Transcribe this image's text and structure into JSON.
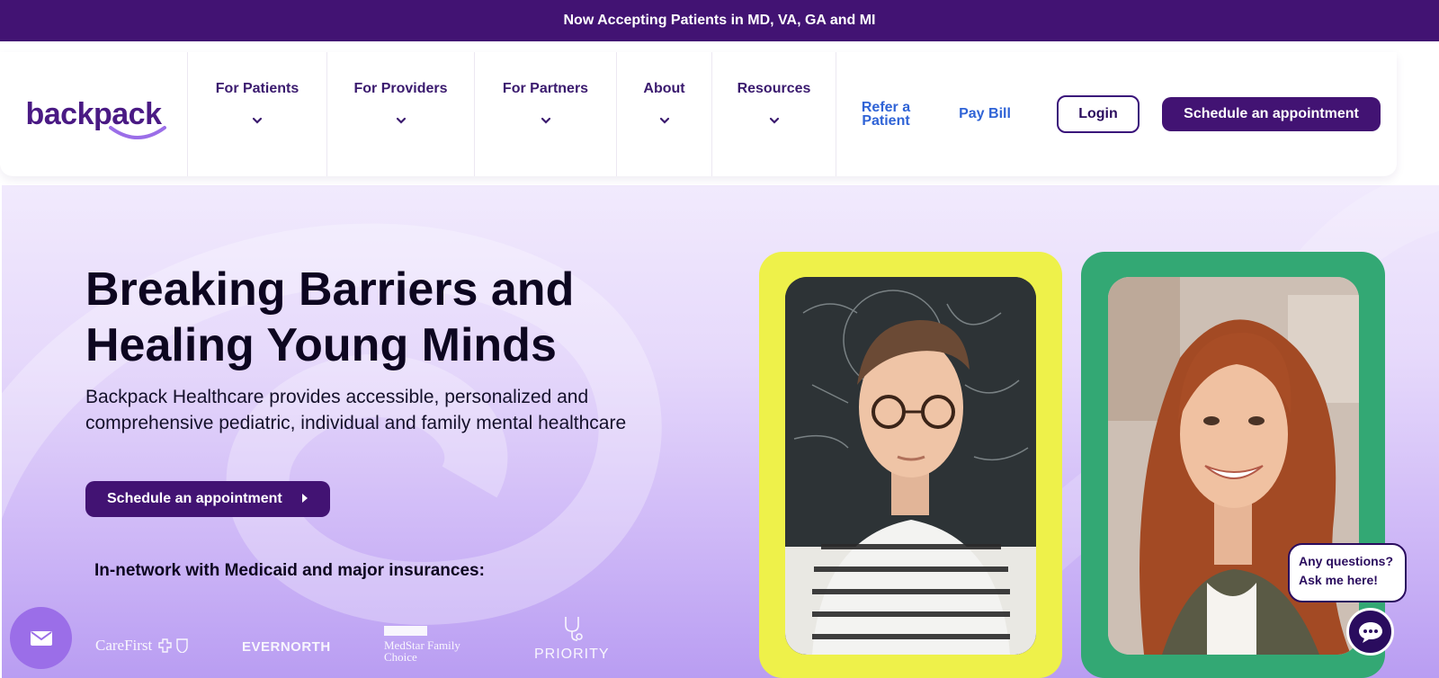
{
  "banner": {
    "text": "Now Accepting Patients in MD, VA, GA and MI"
  },
  "header": {
    "logo_text": "backpack",
    "nav": [
      {
        "label": "For Patients"
      },
      {
        "label": "For Providers"
      },
      {
        "label": "For Partners"
      },
      {
        "label": "About"
      },
      {
        "label": "Resources"
      }
    ],
    "refer_line1": "Refer a",
    "refer_line2": "Patient",
    "pay_bill": "Pay Bill",
    "login": "Login",
    "schedule": "Schedule an appointment"
  },
  "hero": {
    "title_line1": "Breaking Barriers and",
    "title_line2": "Healing Young Minds",
    "subtitle_line1": "Backpack Healthcare provides accessible, personalized and",
    "subtitle_line2": "comprehensive pediatric, individual and family mental healthcare",
    "cta": "Schedule an appointment",
    "insurance_heading": "In-network with Medicaid and major insurances:",
    "insurers": {
      "carefirst": "CareFirst",
      "evernorth": "EVERNORTH",
      "medstar_line1": "MedStar Family",
      "medstar_line2": "Choice",
      "priority": "PRIORITY"
    }
  },
  "chat": {
    "line1": "Any questions?",
    "line2": "Ask me here!"
  },
  "colors": {
    "brand_purple": "#421373",
    "link_blue": "#2f63d6",
    "frame_yellow": "#eef14a",
    "frame_green": "#33a874",
    "mail_fab": "#9b6ee8"
  },
  "icons": [
    "chevron-down-icon",
    "caret-right-icon",
    "envelope-icon",
    "chat-icon",
    "stethoscope-icon",
    "smile-underline-icon"
  ]
}
